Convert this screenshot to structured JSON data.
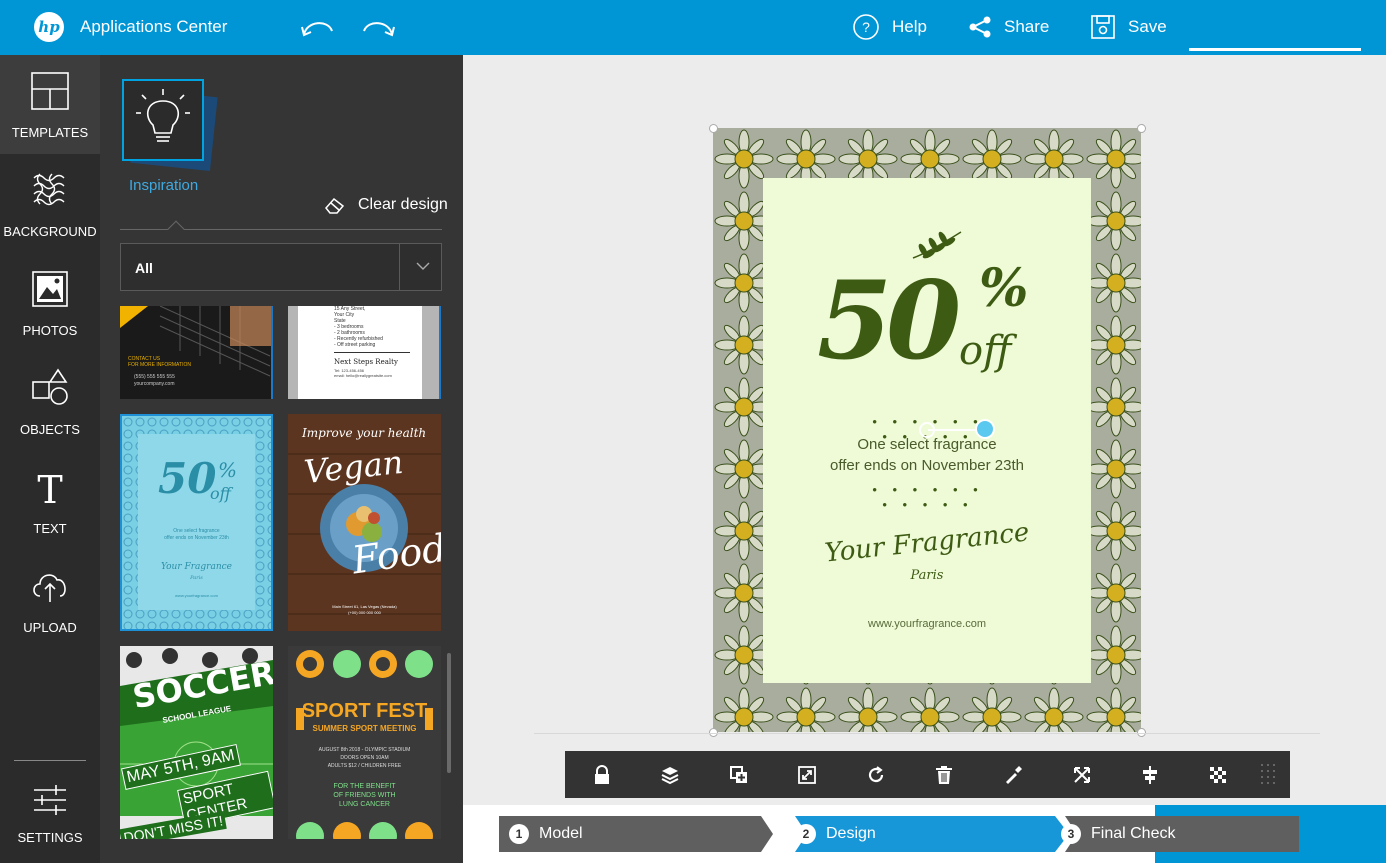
{
  "header": {
    "app_title": "Applications Center",
    "logo_text": "hp",
    "help_label": "Help",
    "share_label": "Share",
    "save_label": "Save"
  },
  "left_nav": {
    "items": [
      {
        "label": "TEMPLATES",
        "icon": "templates-icon",
        "active": true
      },
      {
        "label": "BACKGROUND",
        "icon": "background-icon"
      },
      {
        "label": "PHOTOS",
        "icon": "photos-icon"
      },
      {
        "label": "OBJECTS",
        "icon": "objects-icon"
      },
      {
        "label": "TEXT",
        "icon": "text-icon"
      },
      {
        "label": "UPLOAD",
        "icon": "upload-icon"
      }
    ],
    "settings_label": "SETTINGS"
  },
  "panel": {
    "inspiration_label": "Inspiration",
    "clear_design_label": "Clear design",
    "filter_value": "All",
    "thumbnails": [
      {
        "name": "real-estate-dark-template",
        "lines": [
          "CONTACT US",
          "FOR MORE INFORMATION",
          "(555) 555 555 555",
          "yourcompany.com"
        ]
      },
      {
        "name": "next-steps-realty-template",
        "lines": [
          "15 Any Street,",
          "Your City",
          "State",
          "- 3 bedrooms",
          "- 2 bathrooms",
          "- Recently refurbished",
          "- Off street parking",
          "Next Steps Realty",
          "Tel: 123-456-456",
          "email: hello@reallygreatsite.com"
        ]
      },
      {
        "name": "fragrance-50-off-template",
        "big": "50",
        "pct": "%",
        "off": "off",
        "lines": [
          "One select fragrance",
          "offer ends on November 23th"
        ],
        "brand": "Your Fragrance",
        "brand_sub": "Paris",
        "url": "www.yourfragrance.com"
      },
      {
        "name": "vegan-food-template",
        "top": "Improve your health",
        "title": "Vegan",
        "title2": "Food",
        "address": "Main Street 61, Las Vegas (Nevada)",
        "phone": "(+00) 000 000 000"
      },
      {
        "name": "soccer-school-league-template",
        "title": "SOCCER",
        "sub": "SCHOOL LEAGUE",
        "date": "MAY 5TH, 9AM",
        "place": "SPORT CENTER",
        "tag": "DON'T MISS IT!"
      },
      {
        "name": "sport-fest-template",
        "title": "SPORT FEST",
        "sub": "SUMMER SPORT MEETING",
        "lines": [
          "AUGUST 8th 2018 - OLYMPIC STADIUM",
          "DOORS OPEN 10AM",
          "ADULTS $12 / CHILDREN FREE"
        ],
        "benefit": [
          "FOR THE BENEFIT",
          "OF FRIENDS WITH",
          "LUNG CANCER"
        ]
      }
    ]
  },
  "flyer": {
    "big": "50",
    "pct": "%",
    "off": "off",
    "dots": "• • • • • • • • • • •",
    "offer_line1": "One select fragrance",
    "offer_line2": "offer ends on November 23th",
    "brand": "Your Fragrance",
    "brand_sub": "Paris",
    "url": "www.yourfragrance.com",
    "background_color": "#a9ad9e",
    "card_color": "#eefbd6",
    "text_color": "#3e5b14"
  },
  "toolbar": {
    "tools": [
      "lock-icon",
      "layers-icon",
      "duplicate-icon",
      "resize-icon",
      "rotate-icon",
      "delete-icon",
      "eyedropper-icon",
      "flip-icon",
      "align-icon",
      "transparency-icon",
      "grip-icon"
    ]
  },
  "stepper": {
    "steps": [
      {
        "num": "1",
        "label": "Model",
        "state": "done"
      },
      {
        "num": "2",
        "label": "Design",
        "state": "active"
      },
      {
        "num": "3",
        "label": "Final Check",
        "state": "pending"
      }
    ]
  },
  "colors": {
    "brand_blue": "#0096d6",
    "nav_dark": "#2b2b2b",
    "panel_dark": "#353535",
    "toolbar_dark": "#333333",
    "step_grey": "#5f5f5f",
    "step_blue": "#1797d8",
    "accent_cyan": "#3fa9e0"
  }
}
